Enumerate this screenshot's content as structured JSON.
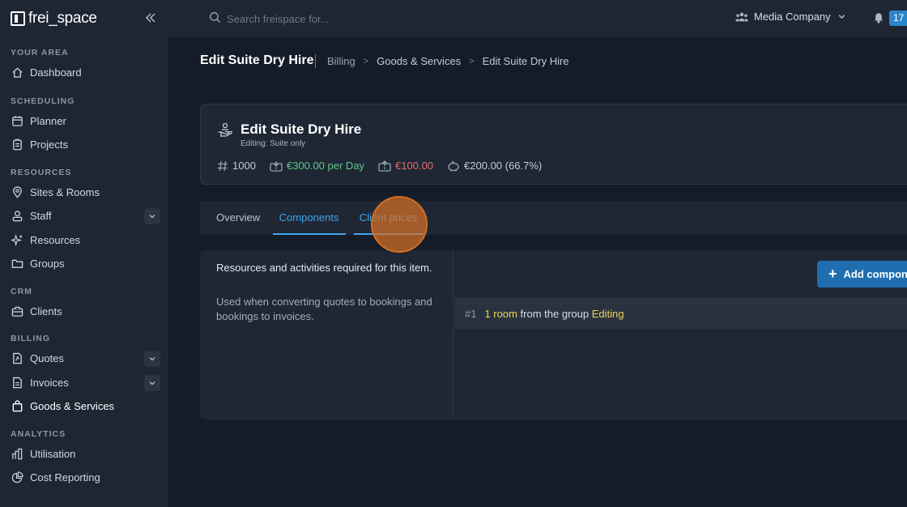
{
  "sidebar": {
    "logo": "frei_space",
    "sections": [
      {
        "title": "YOUR AREA",
        "items": [
          {
            "label": "Dashboard"
          }
        ]
      },
      {
        "title": "SCHEDULING",
        "items": [
          {
            "label": "Planner"
          },
          {
            "label": "Projects"
          }
        ]
      },
      {
        "title": "RESOURCES",
        "items": [
          {
            "label": "Sites & Rooms"
          },
          {
            "label": "Staff"
          },
          {
            "label": "Resources"
          },
          {
            "label": "Groups"
          }
        ]
      },
      {
        "title": "CRM",
        "items": [
          {
            "label": "Clients"
          }
        ]
      },
      {
        "title": "BILLING",
        "items": [
          {
            "label": "Quotes"
          },
          {
            "label": "Invoices"
          },
          {
            "label": "Goods & Services"
          }
        ]
      },
      {
        "title": "ANALYTICS",
        "items": [
          {
            "label": "Utilisation"
          },
          {
            "label": "Cost Reporting"
          }
        ]
      }
    ]
  },
  "topbar": {
    "search_placeholder": "Search freispace for...",
    "company": "Media Company",
    "notification_count": "17"
  },
  "header": {
    "title": "Edit Suite Dry Hire",
    "breadcrumbs": [
      "Billing",
      "Goods & Services",
      "Edit Suite Dry Hire"
    ]
  },
  "item": {
    "name": "Edit Suite Dry Hire",
    "subtitle": "Editing: Suite only",
    "number": "1000",
    "price": "€300.00 per Day",
    "cost": "€100.00",
    "margin": "€200.00 (66.7%)"
  },
  "tabs": [
    {
      "label": "Overview"
    },
    {
      "label": "Components"
    },
    {
      "label": "Client prices"
    }
  ],
  "components": {
    "description": "Resources and activities required for this item.",
    "note": "Used when converting quotes to bookings and bookings to invoices.",
    "add_button": "Add component",
    "rows": [
      {
        "num": "#1",
        "qty": "1 room",
        "text": " from the group ",
        "group": "Editing"
      }
    ]
  },
  "colors": {
    "accent": "#3ea6f0",
    "price_green": "#5fc98a",
    "cost_red": "#e46b6b",
    "highlight_yellow": "#f0d35a"
  }
}
